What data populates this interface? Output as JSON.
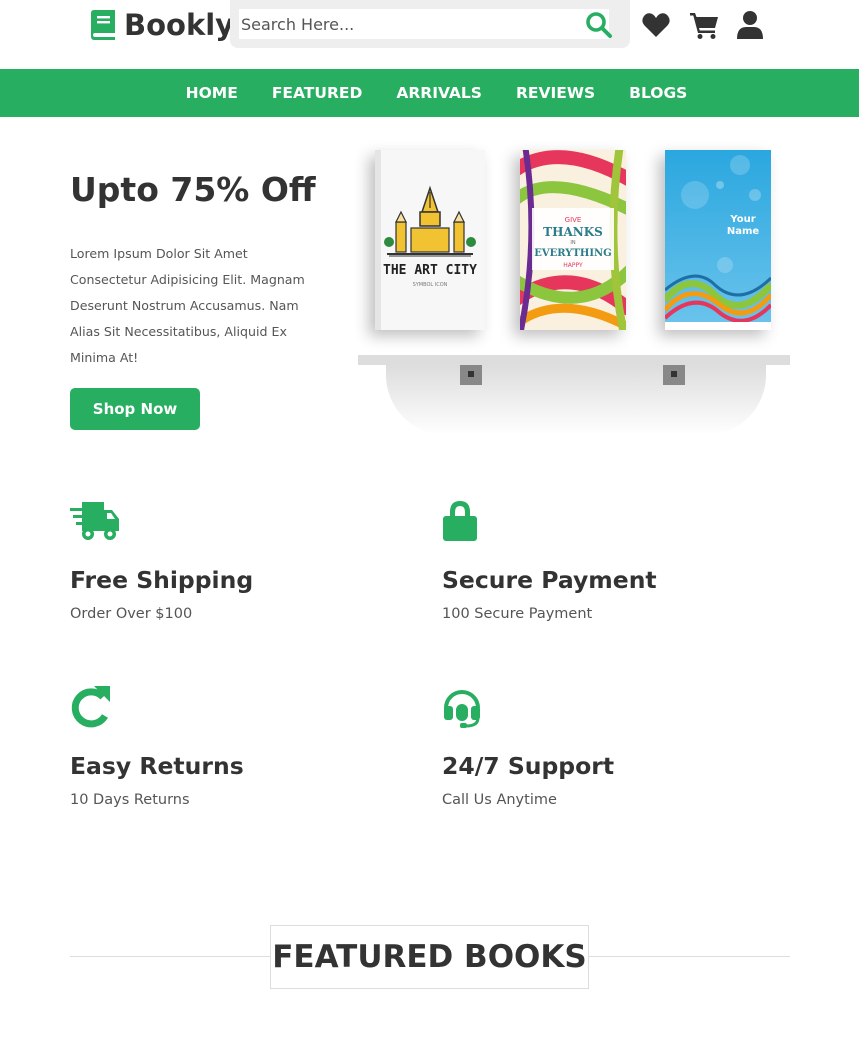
{
  "brand": {
    "name": "Bookly",
    "accent_color": "#27ae60",
    "logo_icon": "book-icon"
  },
  "search": {
    "placeholder": "Search Here...",
    "value": "",
    "icon": "search-icon"
  },
  "header_icons": [
    "heart-icon",
    "cart-icon",
    "user-icon"
  ],
  "nav": {
    "items": [
      {
        "label": "HOME"
      },
      {
        "label": "FEATURED"
      },
      {
        "label": "ARRIVALS"
      },
      {
        "label": "REVIEWS"
      },
      {
        "label": "BLOGS"
      }
    ]
  },
  "hero": {
    "title": "Upto 75% Off",
    "description": "Lorem Ipsum Dolor Sit Amet Consectetur Adipisicing Elit. Magnam Deserunt Nostrum Accusamus. Nam Alias Sit Necessitatibus, Aliquid Ex Minima At!",
    "button_label": "Shop Now",
    "books": [
      {
        "title": "THE ART CITY",
        "subtitle": "SYMBOL ICON"
      },
      {
        "line1": "GIVE",
        "line2": "THANKS",
        "line3": "IN",
        "line4": "EVERYTHING",
        "line5": "HAPPY"
      },
      {
        "line1": "Your",
        "line2": "Name"
      }
    ]
  },
  "features": [
    {
      "icon": "truck-icon",
      "title": "Free Shipping",
      "subtitle": "Order Over $100"
    },
    {
      "icon": "lock-icon",
      "title": "Secure Payment",
      "subtitle": "100 Secure Payment"
    },
    {
      "icon": "redo-icon",
      "title": "Easy Returns",
      "subtitle": "10 Days Returns"
    },
    {
      "icon": "headset-icon",
      "title": "24/7 Support",
      "subtitle": "Call Us Anytime"
    }
  ],
  "featured_section": {
    "heading": "FEATURED BOOKS"
  }
}
